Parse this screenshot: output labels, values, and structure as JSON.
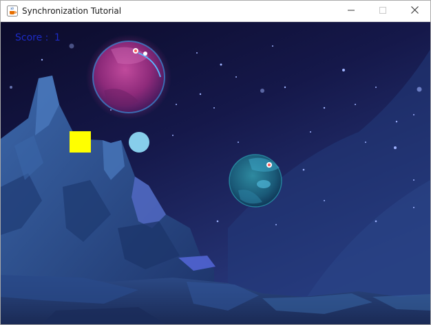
{
  "window": {
    "title": "Synchronization Tutorial",
    "icons": {
      "app": "java-coffee-cup-icon",
      "minimize": "minimize-icon",
      "maximize": "maximize-icon",
      "close": "close-icon"
    }
  },
  "game": {
    "score_label": "Score :",
    "score_value": "1",
    "player_shape": "square",
    "ball_shape": "circle",
    "colors": {
      "score_text": "#1d2bc8",
      "player": "#ffff00",
      "ball": "#87ceeb",
      "sky_top": "#0e0d2e",
      "sky_bottom": "#27377a",
      "planet_pink": "#b0338c",
      "planet_teal": "#1f6a85",
      "mountains": "#2b4a86",
      "ground": "#223864"
    }
  }
}
